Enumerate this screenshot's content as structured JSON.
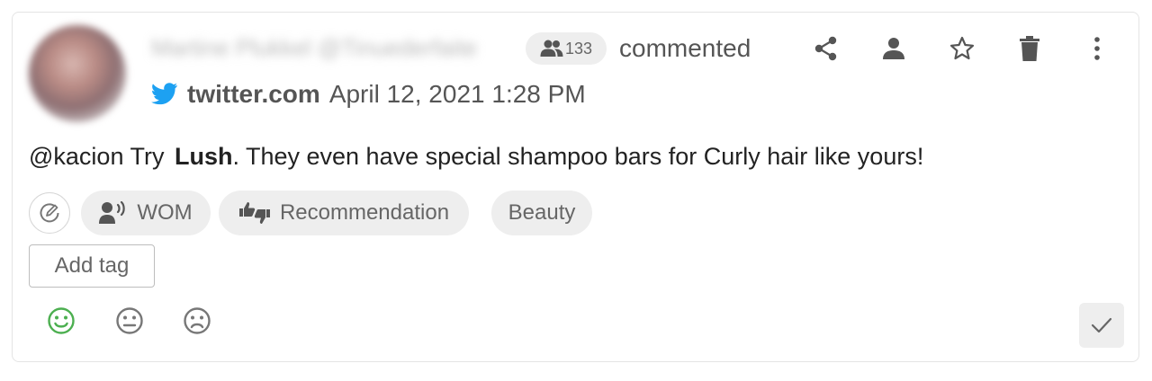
{
  "post": {
    "author": "Martine Plukkel @Tinuederfaite",
    "followers": "133",
    "action": "commented",
    "source_site": "twitter.com",
    "date": "April 12, 2021 1:28 PM",
    "text_before": "@kacion Try",
    "text_bold": "Lush",
    "text_after": ". They even have special shampoo bars for Curly hair like yours!"
  },
  "toolbar": {
    "icons": [
      "share-icon",
      "person-icon",
      "star-icon",
      "trash-icon",
      "more-vertical-icon"
    ]
  },
  "tags": {
    "items": [
      {
        "label": "WOM",
        "icon": "speaker-person-icon"
      },
      {
        "label": "Recommendation",
        "icon": "thumbs-up-down-icon"
      },
      {
        "label": "Beauty",
        "icon": null
      }
    ],
    "add_label": "Add tag"
  },
  "sentiment": {
    "options": [
      "positive",
      "neutral",
      "negative"
    ],
    "selected": "positive",
    "colors": {
      "selected": "#4caf50",
      "default": "#777777"
    }
  },
  "colors": {
    "twitter": "#1da1f2",
    "chip_bg": "#eeeeee",
    "muted_text": "#555555"
  }
}
